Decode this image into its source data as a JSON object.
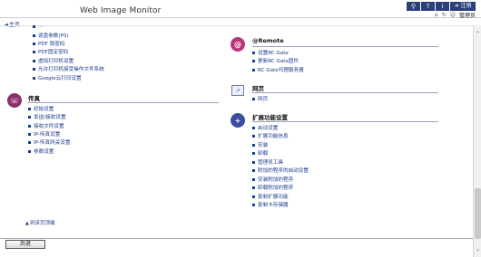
{
  "header": {
    "app_title": "Web Image Monitor",
    "icons": [
      "search-icon",
      "help-icon",
      "info-icon",
      "logout-icon"
    ],
    "help_glyph": "?",
    "info_glyph": "i",
    "logout_label": "注销",
    "admin_label": "管理员"
  },
  "nav": {
    "home_label": "主页",
    "back_to_top": "到该页顶端",
    "back_button": "后退"
  },
  "left": {
    "top_items": [
      "...",
      "读盘参数(PS)",
      "PDF 锁密码",
      "PDF固定密码",
      "虚拟打印机设置",
      "允许打印机接受操作文件系统",
      "Google云打印设置"
    ],
    "fax": {
      "title": "传真",
      "items": [
        "初始设置",
        "发送/接收设置",
        "接收文件设置",
        "IP-传真设置",
        "IP-传真网关设置",
        "参数设置"
      ]
    }
  },
  "right": {
    "remote": {
      "title": "@Remote",
      "items": [
        "设置RC Gate",
        "更新RC Gate固件",
        "RC Gate代理服务器"
      ]
    },
    "webpage": {
      "title": "网页",
      "items": [
        "网页"
      ]
    },
    "extended": {
      "title": "扩展功能设置",
      "items": [
        "启动设置",
        "扩展功能信息",
        "安装",
        "卸载",
        "管理员工具",
        "附加的程序的启动设置",
        "安装附加的程序",
        "卸载附加的程序",
        "复制扩展功能",
        "复制卡存储器"
      ]
    }
  },
  "colors": {
    "link": "#1c3a8c",
    "header_icon_bg": "#2b3f78",
    "fax_icon": "#8e2f6d",
    "remote_icon": "#b7377a",
    "ext_icon": "#3b4fa0"
  }
}
